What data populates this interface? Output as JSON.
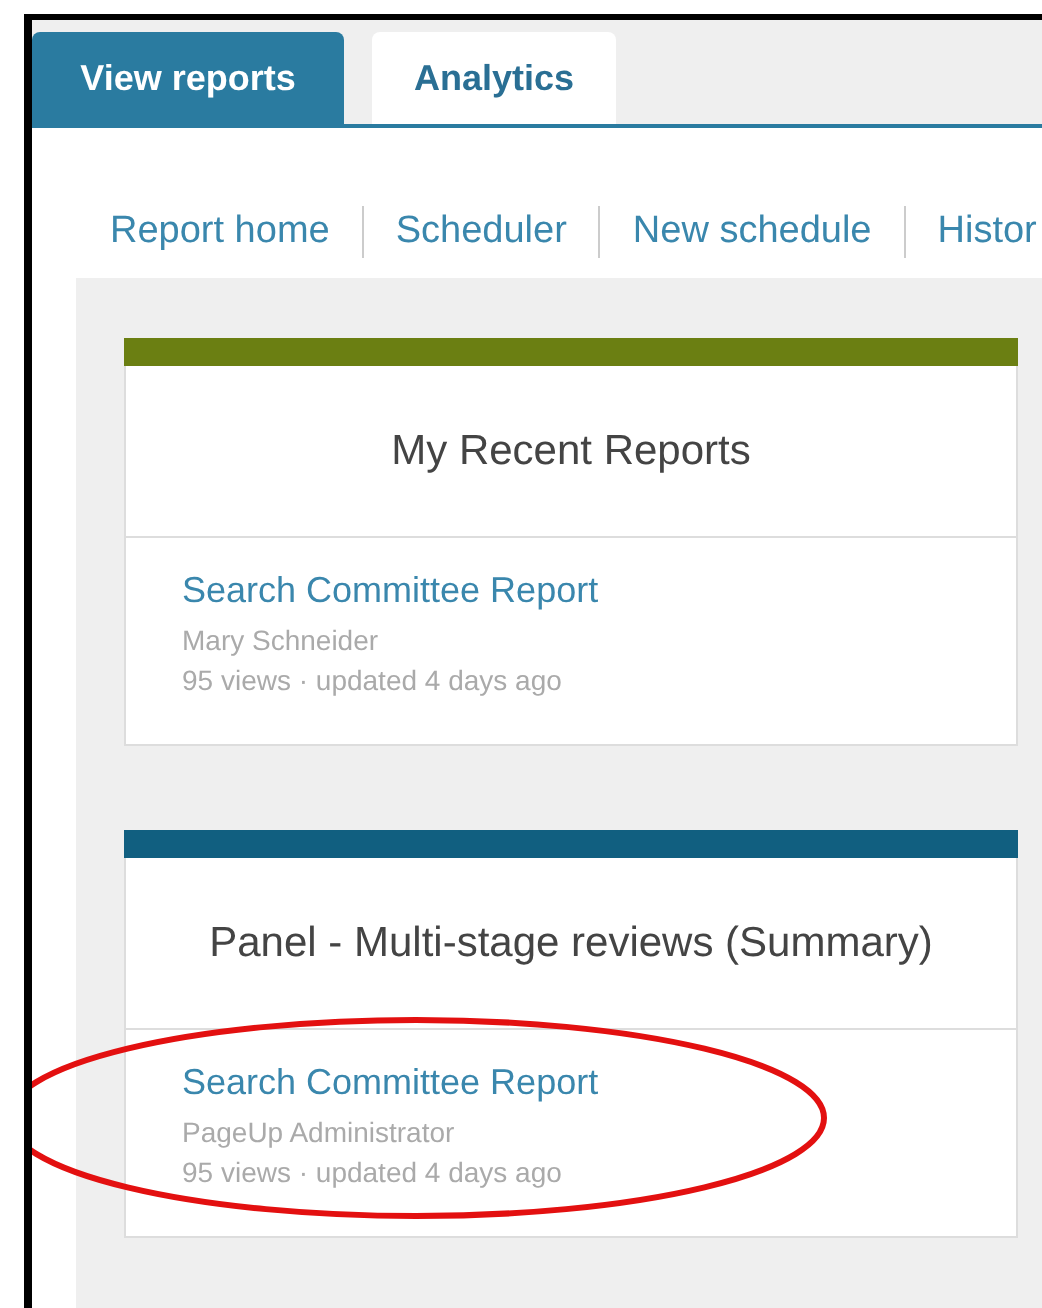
{
  "tabs": [
    {
      "label": "View reports",
      "selected": true
    },
    {
      "label": "Analytics",
      "selected": false
    }
  ],
  "nav": [
    "Report home",
    "Scheduler",
    "New schedule",
    "Histor"
  ],
  "cards": [
    {
      "title": "My Recent Reports",
      "color": "#6b7f12",
      "reports": [
        {
          "name": "Search Committee Report",
          "owner": "Mary Schneider",
          "meta": "95 views · updated 4 days ago"
        }
      ]
    },
    {
      "title": "Panel - Multi-stage reviews (Summary)",
      "color": "#115f80",
      "reports": [
        {
          "name": "Search Committee Report",
          "owner": "PageUp Administrator",
          "meta": "95 views · updated 4 days ago",
          "highlighted": true
        }
      ]
    }
  ]
}
